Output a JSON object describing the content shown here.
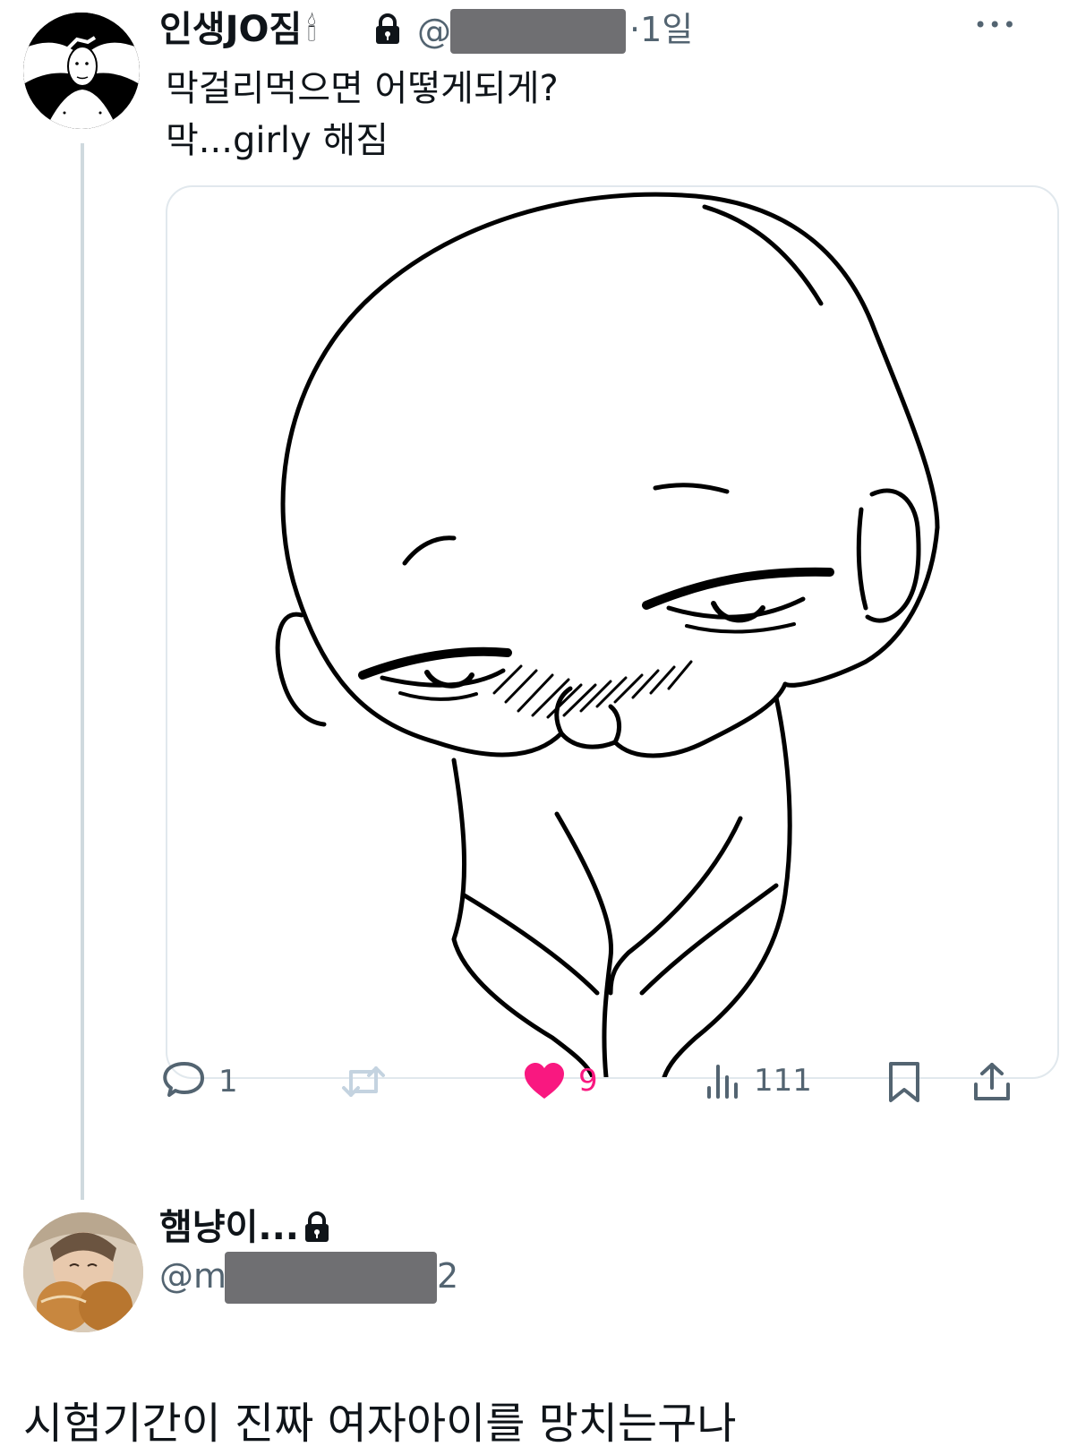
{
  "main_tweet": {
    "display_name": "인생JO짐",
    "name_emoji": "🕯",
    "handle_prefix": "@",
    "time": "·1일",
    "more_label": "•••",
    "text_line1": "막걸리먹으면 어떻게되게?",
    "text_line2": "막...girly 해짐",
    "icons": {
      "lock": "lock-icon",
      "more": "more-dots-icon",
      "media": "blushing-bald-character-drawing"
    },
    "actions": {
      "reply_count": "1",
      "retweet_count": "",
      "like_count": "9",
      "views_count": "111"
    }
  },
  "reply": {
    "display_name": "햄냥이...",
    "handle_prefix": "@m",
    "handle_suffix": "2",
    "text": "시험기간이 진짜 여자아이를 망치는구나"
  },
  "colors": {
    "like": "#f91880",
    "muted": "#536471",
    "retweet_disabled": "#c4d3e0",
    "thread_line": "#cfd9de",
    "redaction": "#6f6f72"
  }
}
